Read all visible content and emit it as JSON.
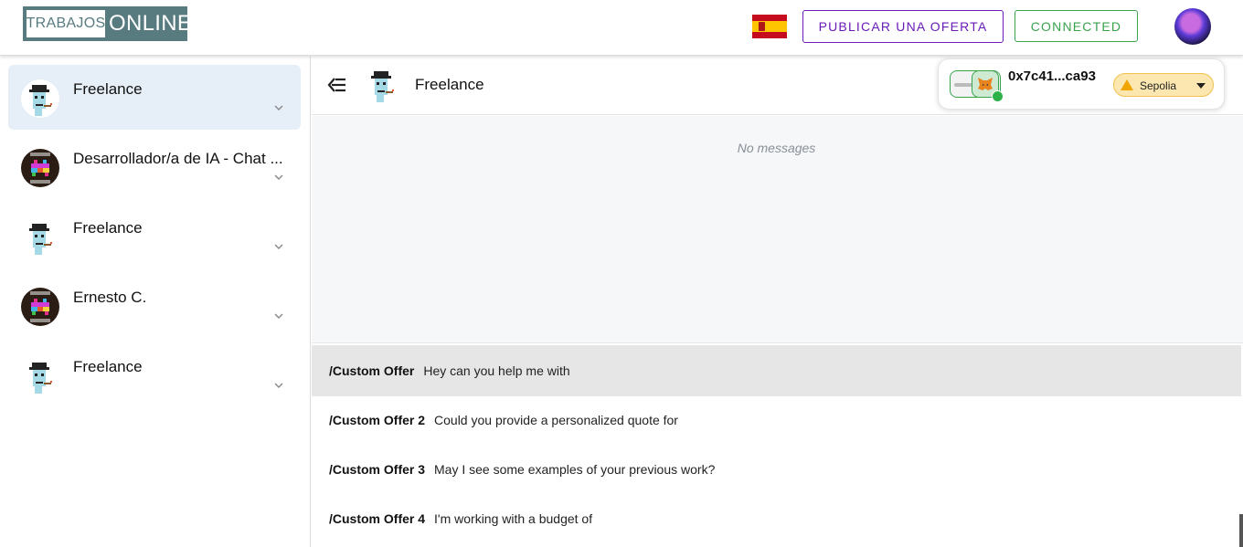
{
  "brand": {
    "left": "TRABAJOS",
    "right": "ONLINE"
  },
  "header": {
    "publish_label": "PUBLICAR UNA OFERTA",
    "connected_label": "CONNECTED"
  },
  "colors": {
    "accent_purple": "#6a1bb8",
    "accent_green": "#3aa34d",
    "logo_bg": "#587b80"
  },
  "sidebar": {
    "items": [
      {
        "name": "Freelance",
        "avatar": "punk-avatar"
      },
      {
        "name": "Desarrollador/a de IA - Chat ...",
        "avatar": "retro-games-avatar"
      },
      {
        "name": "Freelance",
        "avatar": "punk-avatar"
      },
      {
        "name": "Ernesto C.",
        "avatar": "retro-games-avatar"
      },
      {
        "name": "Freelance",
        "avatar": "punk-avatar"
      }
    ]
  },
  "chat": {
    "title": "Freelance",
    "empty_text": "No messages"
  },
  "offers": [
    {
      "command": "/Custom Offer",
      "text": "Hey can you help me with"
    },
    {
      "command": "/Custom Offer 2",
      "text": "Could you provide a personalized quote for"
    },
    {
      "command": "/Custom Offer 3",
      "text": "May I see some examples of your previous work?"
    },
    {
      "command": "/Custom Offer 4",
      "text": "I'm working with a budget of"
    }
  ],
  "wallet": {
    "address": "0x7c41...ca93",
    "network": "Sepolia"
  }
}
